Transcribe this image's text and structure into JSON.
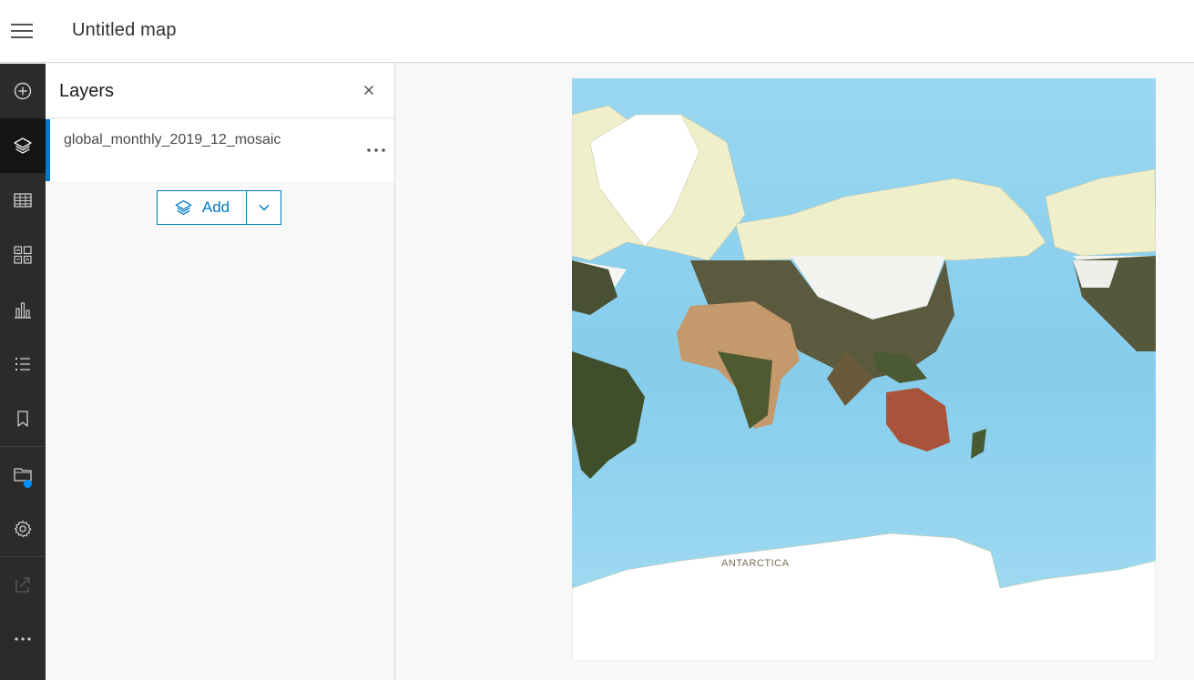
{
  "app": {
    "title": "Untitled map"
  },
  "actionbar": {
    "items": [
      {
        "name": "add-icon"
      },
      {
        "name": "layers-icon"
      },
      {
        "name": "table-icon"
      },
      {
        "name": "legend-icon"
      },
      {
        "name": "chart-icon"
      },
      {
        "name": "list-icon"
      },
      {
        "name": "bookmark-icon"
      },
      {
        "name": "folder-icon"
      },
      {
        "name": "gear-icon"
      },
      {
        "name": "share-icon"
      },
      {
        "name": "more-icon"
      }
    ],
    "active": "layers-icon",
    "colors": {
      "background": "#2b2b2b",
      "active": "#151515",
      "notification": "#0091ff"
    }
  },
  "panel": {
    "title": "Layers",
    "layers": [
      {
        "name": "global_monthly_2019_12_mosaic"
      }
    ],
    "add_label": "Add"
  },
  "map": {
    "labels": {
      "antarctica": "ANTARCTICA"
    },
    "colors": {
      "ocean": "#8fd1ee",
      "land": "#efefcc",
      "accent": "#007ac2"
    }
  }
}
